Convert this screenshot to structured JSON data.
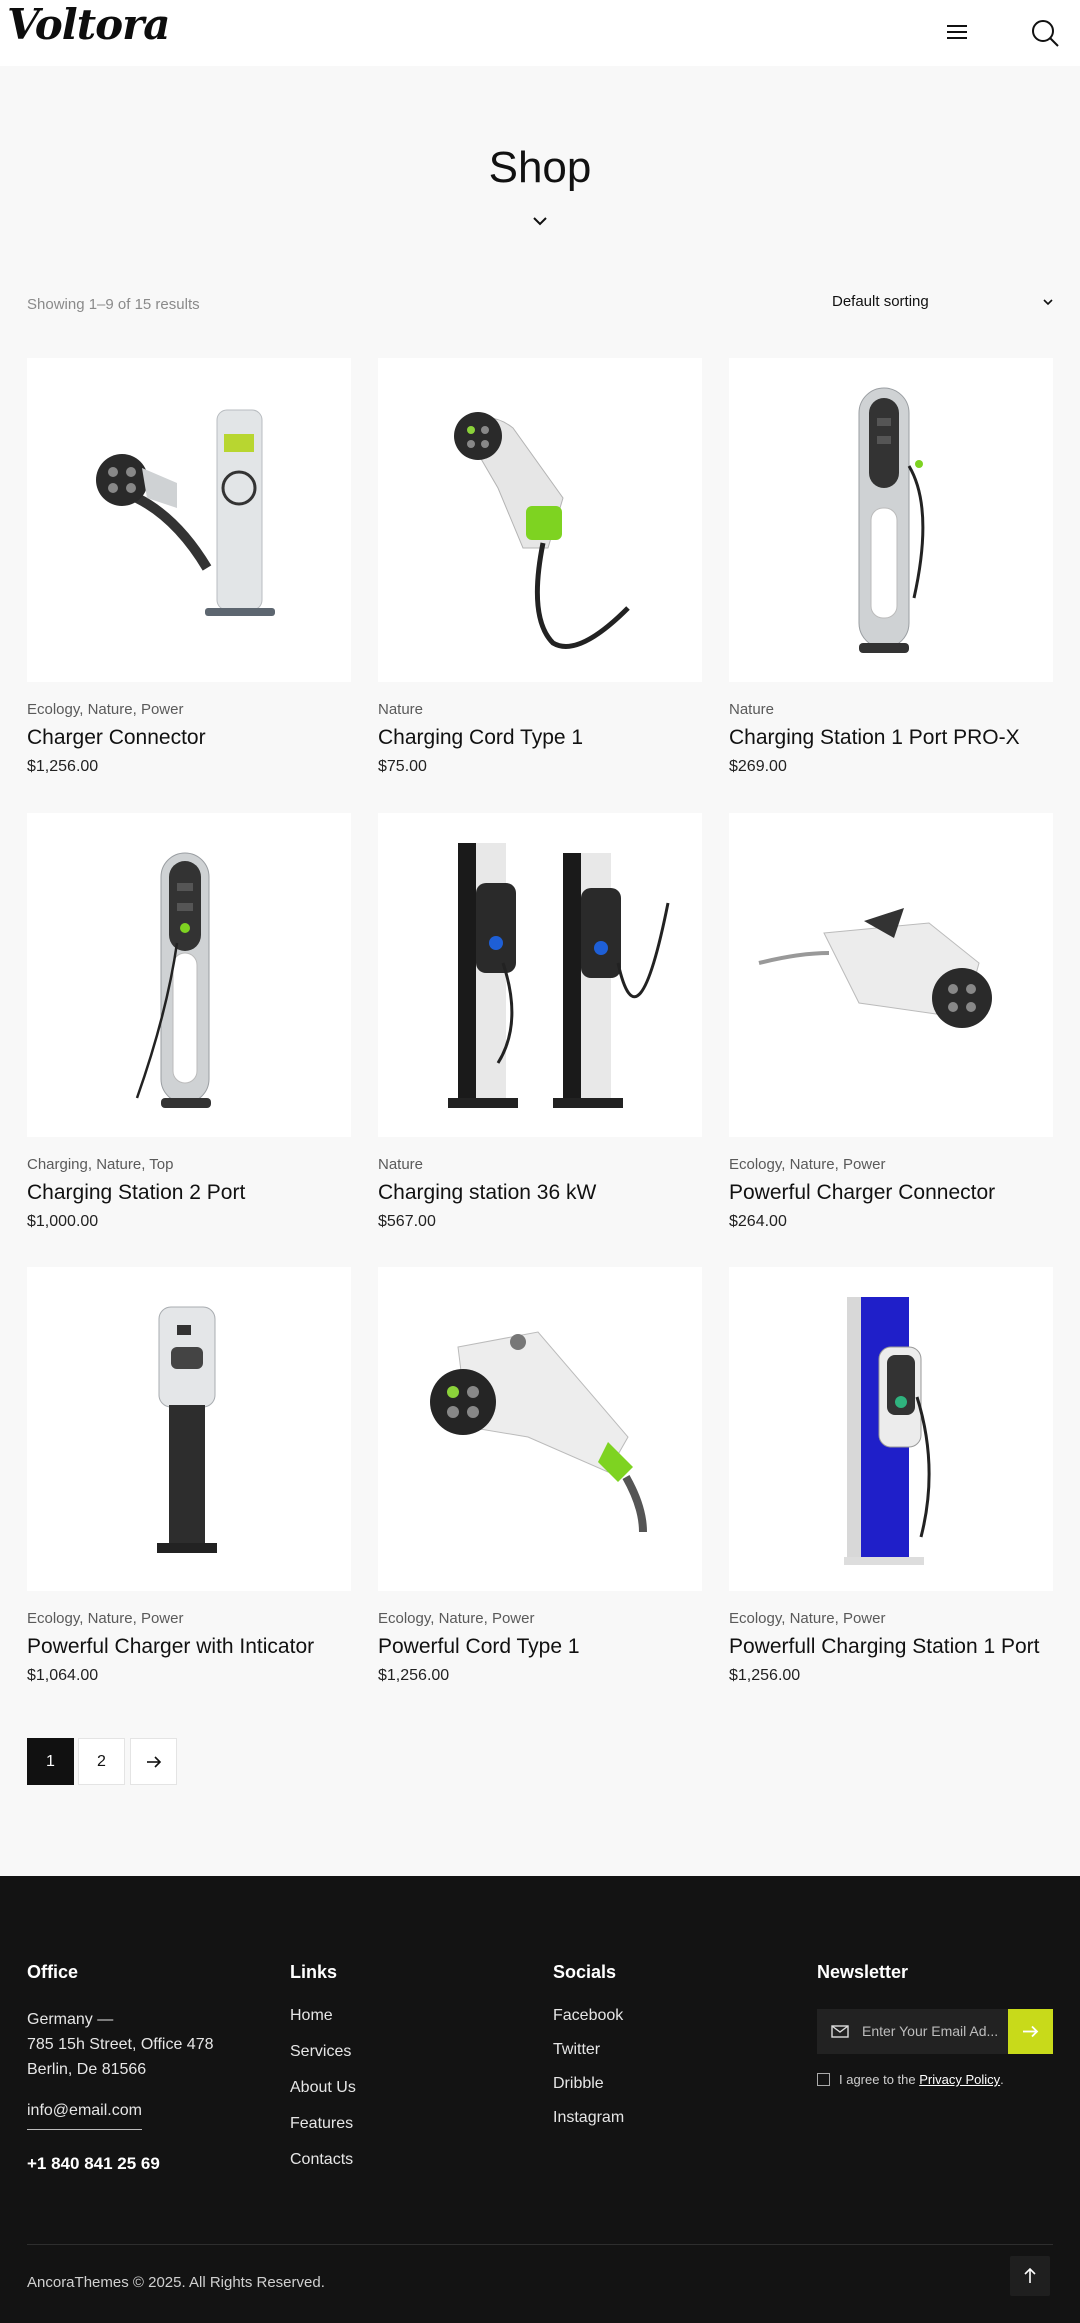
{
  "header": {
    "logo": "Voltora",
    "menu_icon": "hamburger-menu-icon",
    "search_icon": "search-icon"
  },
  "page": {
    "title": "Shop"
  },
  "toolbar": {
    "results": "Showing 1–9 of 15 results",
    "sorting": "Default sorting"
  },
  "products": [
    {
      "categories": "Ecology, Nature, Power",
      "name": "Charger Connector",
      "price": "$1,256.00"
    },
    {
      "categories": "Nature",
      "name": "Charging Cord Type 1",
      "price": "$75.00"
    },
    {
      "categories": "Nature",
      "name": "Charging Station 1 Port PRO-X",
      "price": "$269.00"
    },
    {
      "categories": "Charging, Nature, Top",
      "name": "Charging Station 2 Port",
      "price": "$1,000.00"
    },
    {
      "categories": "Nature",
      "name": "Charging station 36 kW",
      "price": "$567.00"
    },
    {
      "categories": "Ecology, Nature, Power",
      "name": "Powerful Charger Connector",
      "price": "$264.00"
    },
    {
      "categories": "Ecology, Nature, Power",
      "name": "Powerful Charger with Inticator",
      "price": "$1,064.00"
    },
    {
      "categories": "Ecology, Nature, Power",
      "name": "Powerful Cord Type 1",
      "price": "$1,256.00"
    },
    {
      "categories": "Ecology, Nature, Power",
      "name": "Powerfull Charging Station 1 Port",
      "price": "$1,256.00"
    }
  ],
  "pagination": {
    "pages": [
      "1",
      "2"
    ],
    "current": "1",
    "next_icon": "arrow-right-icon"
  },
  "footer": {
    "office": {
      "heading": "Office",
      "line1": "Germany —",
      "line2": "785 15h Street, Office 478",
      "line3": "Berlin, De 81566",
      "email": "info@email.com",
      "phone": "+1 840 841 25 69"
    },
    "links": {
      "heading": "Links",
      "items": [
        "Home",
        "Services",
        "About Us",
        "Features",
        "Contacts"
      ]
    },
    "socials": {
      "heading": "Socials",
      "items": [
        "Facebook",
        "Twitter",
        "Dribble",
        "Instagram"
      ]
    },
    "newsletter": {
      "heading": "Newsletter",
      "placeholder": "Enter Your Email Ad...",
      "agree_text": "I agree to the ",
      "policy_link": "Privacy Policy",
      "agree_end": "."
    },
    "copyright": "AncoraThemes © 2025. All Rights Reserved."
  },
  "colors": {
    "accent": "#c8da1a",
    "footer_bg": "#131313",
    "page_bg": "#f8f8f8"
  }
}
